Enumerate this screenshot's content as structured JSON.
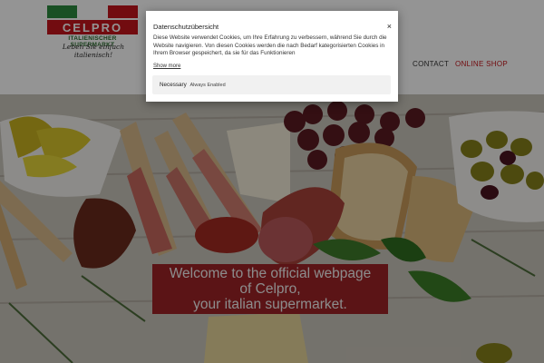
{
  "logo": {
    "name": "CELPRO",
    "subtitle": "ITALIENISCHER SUPERMARKT",
    "tagline": "Leben Sie einfach italienisch!"
  },
  "nav": {
    "contact": "CONTACT",
    "shop": "ONLINE SHOP"
  },
  "hero": {
    "welcome_line1": "Welcome to the official webpage",
    "welcome_line2": "of Celpro,",
    "welcome_line3": "your italian supermarket."
  },
  "cookie": {
    "title": "Datenschutzübersicht",
    "close": "×",
    "text": "Diese Website verwendet Cookies, um Ihre Erfahrung zu verbessern, während Sie durch die Website navigieren. Von diesen Cookies werden die nach Bedarf kategorisierten Cookies in Ihrem Browser gespeichert, da sie für das Funktionieren",
    "show_more": "Show more",
    "necessary_label": "Necessary",
    "necessary_status": "Always Enabled"
  },
  "colors": {
    "accent_red": "#c4161c",
    "banner_red": "#9e2426",
    "flag_green": "#2b8a3e",
    "flag_red": "#c4161c"
  }
}
